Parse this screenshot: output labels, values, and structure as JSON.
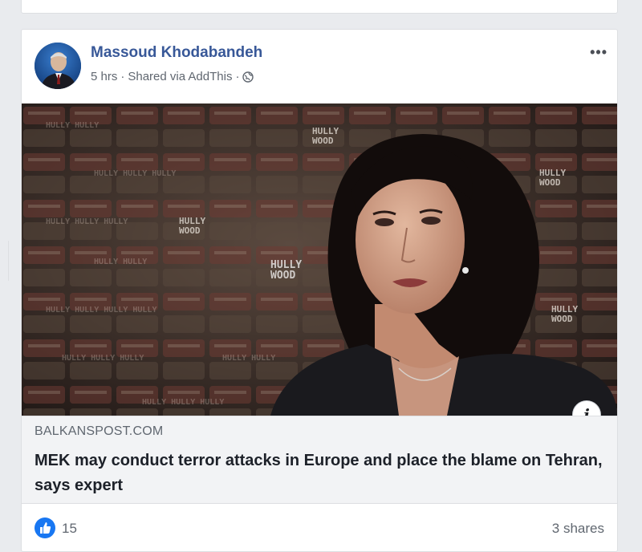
{
  "post": {
    "author": "Massoud Khodabandeh",
    "time": "5 hrs",
    "separator": "·",
    "shared_via": "Shared via AddThis",
    "separator2": "·",
    "more_label": "•••",
    "privacy_icon": "globe-icon"
  },
  "link": {
    "domain": "BALKANSPOST.COM",
    "headline": "MEK may conduct terror attacks in Europe and place the blame on Tehran, says expert",
    "info_label": "i"
  },
  "media": {
    "backdrop_text": "HULLY WOOD"
  },
  "footer": {
    "like_count": "15",
    "shares": "3 shares"
  },
  "colors": {
    "author": "#385898",
    "like": "#1877f2",
    "link_bg": "#f2f3f5"
  }
}
